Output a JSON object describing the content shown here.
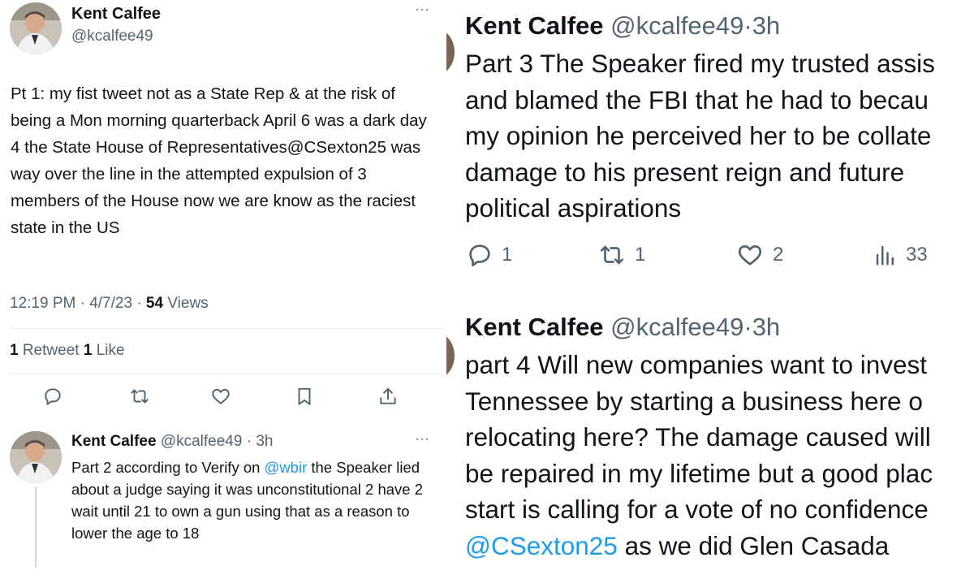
{
  "tweet1": {
    "name": "Kent Calfee",
    "handle": "@kcalfee49",
    "more": "···",
    "body": "Pt 1: my fist tweet not as a State Rep & at the risk of being a Mon morning quarterback April 6 was a dark day 4 the State House of Representatives@CSexton25  was way over the line in the attempted expulsion of 3 members of the House now we are know as the raciest state in the US",
    "time": "12:19 PM · 4/7/23 · ",
    "views_count": "54",
    "views_label": " Views",
    "retweet_count": "1",
    "retweet_label": " Retweet ",
    "like_count": "1",
    "like_label": " Like",
    "actions": [
      "reply-icon",
      "retweet-icon",
      "like-icon",
      "bookmark-icon",
      "share-icon"
    ]
  },
  "tweet2": {
    "name": "Kent Calfee",
    "handle": "@kcalfee49",
    "dot": " · ",
    "time": "3h",
    "more": "···",
    "body_before": "Part 2 according to Verify on ",
    "mention": "@wbir",
    "body_after": " the Speaker lied about a judge saying it was unconstitutional 2 have 2 wait until 21 to own a gun using that as a reason to lower the age to 18"
  },
  "tweet3": {
    "name": "Kent Calfee",
    "handle": "@kcalfee49",
    "dot": "·",
    "time": "3h",
    "lines": [
      "Part 3 The Speaker fired my trusted assis",
      "and blamed the FBI that he had to becau",
      "my opinion he perceived her to be collate",
      "damage to his present reign and future",
      "political aspirations"
    ],
    "reply_count": "1",
    "retweet_count": "1",
    "like_count": "2",
    "views_count": "33"
  },
  "tweet4": {
    "name": "Kent Calfee",
    "handle": "@kcalfee49",
    "dot": "·",
    "time": "3h",
    "lines": [
      "part 4 Will new companies want to invest",
      "Tennessee  by starting a business here o",
      "relocating here? The damage caused will",
      "be repaired in my lifetime but a good plac",
      "start is calling for a vote of no confidence"
    ],
    "mention": "@CSexton25",
    "last_line_rest": " as we did Glen Casada"
  },
  "colors": {
    "text": "#0f1419",
    "secondary": "#536471",
    "link": "#1d9bf0",
    "divider": "#e6ecf0"
  }
}
